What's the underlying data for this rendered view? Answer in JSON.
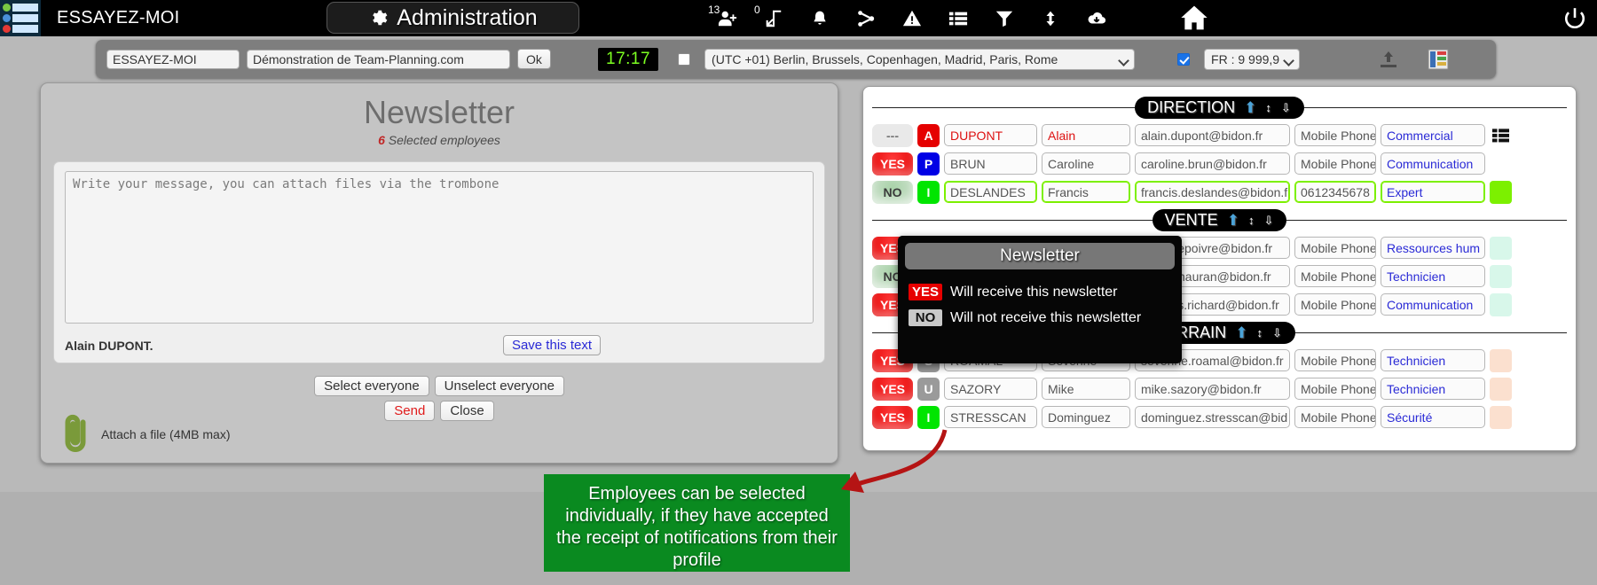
{
  "topbar": {
    "company": "ESSAYEZ-MOI",
    "admin_label": "Administration",
    "gear_icon": "gear-icon",
    "icons": [
      {
        "name": "add-user-icon",
        "badge": "13"
      },
      {
        "name": "swap-arrows-icon",
        "badge": "0"
      },
      {
        "name": "bell-icon",
        "badge": ""
      },
      {
        "name": "share-icon",
        "badge": ""
      },
      {
        "name": "warning-icon",
        "badge": ""
      },
      {
        "name": "list-icon",
        "badge": ""
      },
      {
        "name": "filter-icon",
        "badge": ""
      },
      {
        "name": "sort-updown-icon",
        "badge": ""
      },
      {
        "name": "cloud-download-icon",
        "badge": ""
      }
    ],
    "home_icon": "home-icon",
    "power_icon": "power-icon"
  },
  "toolbar": {
    "company_value": "ESSAYEZ-MOI",
    "description_value": "Démonstration de Team-Planning.com",
    "ok_label": "Ok",
    "clock": "17:17",
    "tz_checkbox_checked": false,
    "timezone_value": "(UTC +01) Berlin, Brussels, Copenhagen, Madrid, Paris, Rome",
    "format_checkbox_checked": true,
    "number_format_value": "FR : 9 999,99",
    "upload_icon": "upload-icon",
    "grid_icon": "grid-layout-icon"
  },
  "newsletter": {
    "title": "Newsletter",
    "selected_count": "6",
    "selected_label": "Selected employees",
    "message_placeholder": "Write your message, you can attach files via the trombone",
    "message_value": "",
    "signature": "Alain DUPONT.",
    "save_label": "Save this text",
    "select_everyone_label": "Select everyone",
    "unselect_everyone_label": "Unselect everyone",
    "send_label": "Send",
    "close_label": "Close",
    "attach_icon": "paperclip-icon",
    "attach_label": "Attach a file (4MB max)"
  },
  "tooltip": {
    "title": "Newsletter",
    "yes_tag": "YES",
    "yes_text": "Will receive this newsletter",
    "no_tag": "NO",
    "no_text": "Will not receive this newsletter"
  },
  "callout": {
    "text": "Employees can be selected individually, if they have accepted the receipt of notifications from their profile"
  },
  "employee_groups": [
    {
      "name": "DIRECTION",
      "up_icon": "arrow-up-icon",
      "collapse_icon": "collapse-icon",
      "expand_icon": "chevron-double-down-icon",
      "rows": [
        {
          "newsletter": "---",
          "nl_state": "none",
          "initial": "A",
          "initial_color": "#e50000",
          "last_name": "DUPONT",
          "first_name": "Alain",
          "email": "alain.dupont@bidon.fr",
          "phone": "Mobile Phone",
          "job": "Commercial",
          "swatch": "",
          "highlight": false,
          "text_color": "#d11",
          "has_menu": true
        },
        {
          "newsletter": "YES",
          "nl_state": "yes",
          "initial": "P",
          "initial_color": "#0000e5",
          "last_name": "BRUN",
          "first_name": "Caroline",
          "email": "caroline.brun@bidon.fr",
          "phone": "Mobile Phone",
          "job": "Communication",
          "swatch": "",
          "highlight": false,
          "text_color": "",
          "has_menu": false
        },
        {
          "newsletter": "NO",
          "nl_state": "no",
          "initial": "I",
          "initial_color": "#00e500",
          "last_name": "DESLANDES",
          "first_name": "Francis",
          "email": "francis.deslandes@bidon.f",
          "phone": "0612345678",
          "job": "Expert",
          "swatch": "#7cf000",
          "highlight": true,
          "text_color": "",
          "has_menu": false
        }
      ]
    },
    {
      "name": "VENTE",
      "up_icon": "arrow-up-icon",
      "collapse_icon": "collapse-icon",
      "expand_icon": "chevron-double-down-icon",
      "rows": [
        {
          "newsletter": "YES",
          "nl_state": "yes",
          "initial": "",
          "initial_color": "#888",
          "last_name": "",
          "first_name": "",
          "email": "atrice.lepoivre@bidon.fr",
          "phone": "Mobile Phone",
          "job": "Ressources hum",
          "swatch": "#d8f7ea",
          "highlight": false,
          "text_color": "",
          "has_menu": false
        },
        {
          "newsletter": "NO",
          "nl_state": "no",
          "initial": "",
          "initial_color": "#888",
          "last_name": "",
          "first_name": "",
          "email": "nadia.mauran@bidon.fr",
          "phone": "Mobile Phone",
          "job": "Technicien",
          "swatch": "#d8f7ea",
          "highlight": false,
          "text_color": "",
          "has_menu": false
        },
        {
          "newsletter": "YES",
          "nl_state": "yes",
          "initial": "",
          "initial_color": "#888",
          "last_name": "",
          "first_name": "",
          "email": "jacques.richard@bidon.fr",
          "phone": "Mobile Phone",
          "job": "Communication",
          "swatch": "#d8f7ea",
          "highlight": false,
          "text_color": "",
          "has_menu": false
        }
      ]
    },
    {
      "name": "TERRAIN",
      "up_icon": "arrow-up-icon",
      "collapse_icon": "collapse-icon",
      "expand_icon": "chevron-double-down-icon",
      "rows": [
        {
          "newsletter": "YES",
          "nl_state": "yes",
          "initial": "S",
          "initial_color": "#9a9a9a",
          "last_name": "ROAMAL",
          "first_name": "Severine",
          "email": "severine.roamal@bidon.fr",
          "phone": "Mobile Phone",
          "job": "Technicien",
          "swatch": "#fbe0cf",
          "highlight": false,
          "text_color": "",
          "has_menu": false
        },
        {
          "newsletter": "YES",
          "nl_state": "yes",
          "initial": "U",
          "initial_color": "#9a9a9a",
          "last_name": "SAZORY",
          "first_name": "Mike",
          "email": "mike.sazory@bidon.fr",
          "phone": "Mobile Phone",
          "job": "Technicien",
          "swatch": "#fbe0cf",
          "highlight": false,
          "text_color": "",
          "has_menu": false
        },
        {
          "newsletter": "YES",
          "nl_state": "yes",
          "initial": "I",
          "initial_color": "#00e500",
          "last_name": "STRESSCAN",
          "first_name": "Dominguez",
          "email": "dominguez.stresscan@bid",
          "phone": "Mobile Phone",
          "job": "Sécurité",
          "swatch": "#fbe0cf",
          "highlight": false,
          "text_color": "",
          "has_menu": false
        }
      ]
    }
  ],
  "colors": {
    "accent_red": "#e50000",
    "accent_green": "#7cf000",
    "callout_green": "#0a8a20",
    "clock_green": "#7dff21",
    "link_blue": "#2a2ad6"
  }
}
